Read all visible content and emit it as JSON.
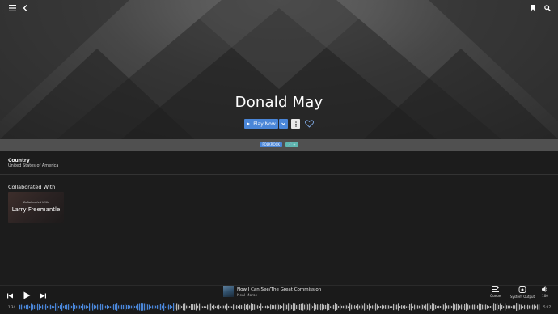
{
  "artist": {
    "name": "Donald May"
  },
  "actions": {
    "play_now": "Play Now"
  },
  "tags": [
    {
      "label": "FOLKROCK",
      "color": "#4a86d8"
    },
    {
      "label": "🔗 +",
      "color": "#5fb6b0"
    }
  ],
  "details": {
    "country_label": "Country",
    "country_value": "United States of America"
  },
  "collaborations": {
    "title": "Collaborated With",
    "items": [
      {
        "caption": "Collaborated With",
        "name": "Larry Freemantle"
      }
    ]
  },
  "player": {
    "track_title": "Now I Can See/The Great Commission",
    "track_artist": "Neal Morse",
    "elapsed": "1:34",
    "duration": "5:17",
    "progress": 0.296,
    "queue_label": "Queue",
    "output_label": "System Output",
    "volume": "100"
  },
  "colors": {
    "accent": "#4a86d8",
    "tag_teal": "#5fb6b0",
    "background": "#1c1c1c"
  },
  "icons": [
    "menu-icon",
    "back-icon",
    "bookmark-icon",
    "search-icon",
    "chevron-down-icon",
    "more-vertical-icon",
    "heart-icon",
    "skip-previous-icon",
    "play-icon",
    "skip-next-icon",
    "queue-icon",
    "speaker-icon",
    "volume-icon"
  ]
}
